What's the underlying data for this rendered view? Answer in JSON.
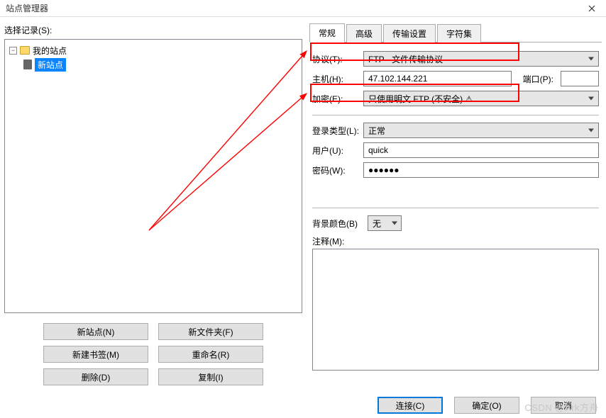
{
  "window": {
    "title": "站点管理器"
  },
  "left": {
    "label": "选择记录(S):",
    "root": "我的站点",
    "site": "新站点",
    "buttons": {
      "new_site": "新站点(N)",
      "new_folder": "新文件夹(F)",
      "new_bookmark": "新建书签(M)",
      "rename": "重命名(R)",
      "delete": "删除(D)",
      "copy": "复制(I)"
    }
  },
  "tabs": {
    "general": "常规",
    "advanced": "高级",
    "transfer": "传输设置",
    "charset": "字符集"
  },
  "form": {
    "protocol_label": "协议(T):",
    "protocol_value": "FTP - 文件传输协议",
    "host_label": "主机(H):",
    "host_value": "47.102.144.221",
    "port_label": "端口(P):",
    "port_value": "",
    "encryption_label": "加密(E):",
    "encryption_value": "只使用明文 FTP (不安全) ⚠",
    "logon_label": "登录类型(L):",
    "logon_value": "正常",
    "user_label": "用户(U):",
    "user_value": "quick",
    "password_label": "密码(W):",
    "password_value": "●●●●●●",
    "bgcolor_label": "背景颜色(B)",
    "bgcolor_value": "无",
    "comment_label": "注释(M):"
  },
  "footer": {
    "connect": "连接(C)",
    "ok": "确定(O)",
    "cancel": "取消"
  },
  "watermark": "CSDN @Ark方舟"
}
